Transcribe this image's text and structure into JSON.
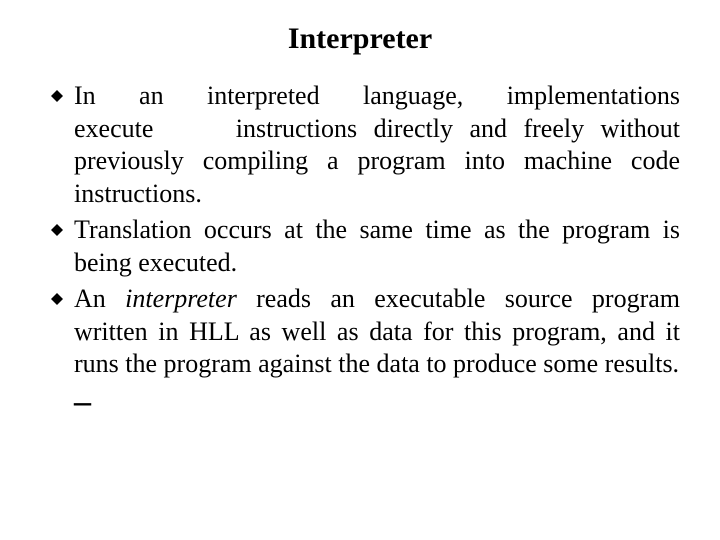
{
  "title": "Interpreter",
  "bullets": {
    "b1_a": "In an interpreted language, implementations execute",
    "b1_b": "instructions directly and freely without previously compiling a program into machine code instructions.",
    "b2": "Translation occurs at the same time as the program is being executed.",
    "b3_a": "An ",
    "b3_italic": "interpreter",
    "b3_b": " reads an executable source program written in HLL as well as data for this program, and it runs the program against the data to produce some results."
  },
  "dash": "–"
}
